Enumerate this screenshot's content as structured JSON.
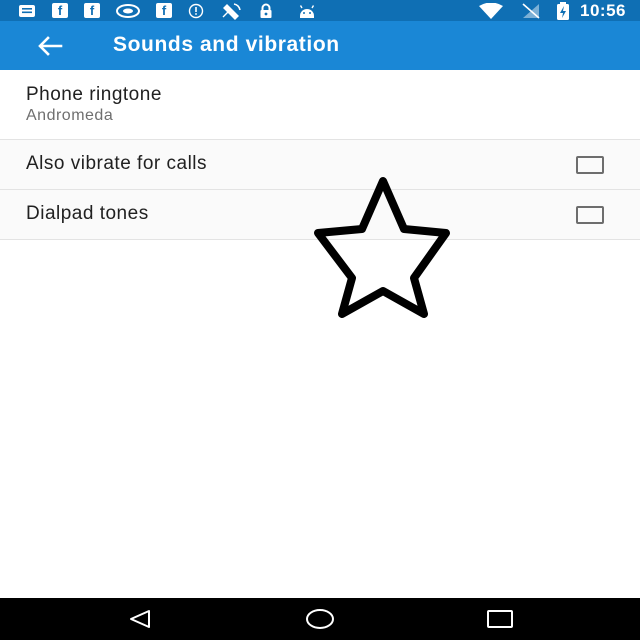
{
  "status_bar": {
    "time": "10:56",
    "icons": [
      "message-icon",
      "facebook-icon",
      "facebook-icon",
      "game-controller-icon",
      "facebook-icon",
      "alert-circle-icon",
      "satellite-icon",
      "lock-icon",
      "android-icon",
      "wifi-icon",
      "signal-icon",
      "battery-charging-icon"
    ],
    "fb_glyph": "f"
  },
  "app_bar": {
    "title": "Sounds and vibration",
    "back_icon": "arrow-back-icon"
  },
  "settings": {
    "ringtone": {
      "title": "Phone ringtone",
      "summary": "Andromeda"
    },
    "vibrate": {
      "title": "Also vibrate for calls",
      "checked": false
    },
    "dialpad": {
      "title": "Dialpad tones",
      "checked": false
    }
  },
  "overlay": {
    "icon": "star-outline-icon"
  },
  "nav_bar": {
    "icons": [
      "back-triangle-icon",
      "home-circle-icon",
      "recents-square-icon"
    ]
  },
  "colors": {
    "status_bar": "#0f6fb4",
    "app_bar": "#1a87d6",
    "text_primary": "#212121",
    "text_secondary": "#6f6f6f"
  }
}
